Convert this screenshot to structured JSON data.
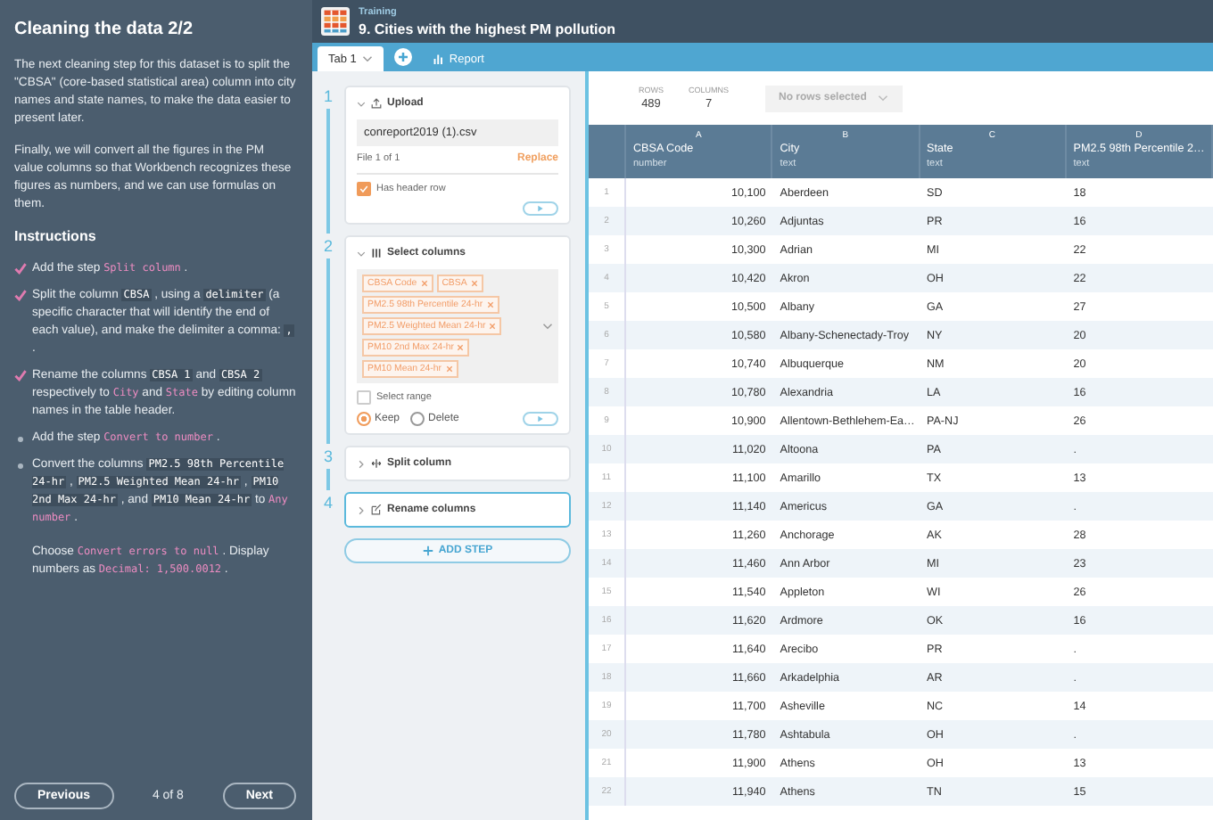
{
  "lesson": {
    "title": "Cleaning the data 2/2",
    "paragraphs": [
      [
        {
          "kind": "text",
          "t": "The next cleaning step for this dataset is to split the \"CBSA\" (core-based statistical area) column into city names and state names, to make the data easier to present later."
        }
      ],
      [
        {
          "kind": "text",
          "t": "Finally, we will convert all the figures in the PM value columns so that Workbench recognizes these figures as numbers, and we can use formulas on them."
        }
      ]
    ],
    "instructions_heading": "Instructions",
    "instructions": [
      {
        "done": true,
        "segments": [
          {
            "kind": "text",
            "t": "Add the step "
          },
          {
            "kind": "accent",
            "t": "Split column"
          },
          {
            "kind": "text",
            "t": " ."
          }
        ]
      },
      {
        "done": true,
        "segments": [
          {
            "kind": "text",
            "t": "Split the column "
          },
          {
            "kind": "code",
            "t": "CBSA"
          },
          {
            "kind": "text",
            "t": " , using a "
          },
          {
            "kind": "code",
            "t": "delimiter"
          },
          {
            "kind": "text",
            "t": " (a specific character that will identify the end of each value), and make the delimiter a comma: "
          },
          {
            "kind": "code",
            "t": ","
          },
          {
            "kind": "text",
            "t": " ."
          }
        ]
      },
      {
        "done": true,
        "segments": [
          {
            "kind": "text",
            "t": "Rename the columns "
          },
          {
            "kind": "code",
            "t": "CBSA 1"
          },
          {
            "kind": "text",
            "t": " and "
          },
          {
            "kind": "code",
            "t": "CBSA 2"
          },
          {
            "kind": "text",
            "t": " respectively to "
          },
          {
            "kind": "accent",
            "t": "City"
          },
          {
            "kind": "text",
            "t": " and "
          },
          {
            "kind": "accent",
            "t": "State"
          },
          {
            "kind": "text",
            "t": " by editing column names in the table header."
          }
        ]
      },
      {
        "done": false,
        "segments": [
          {
            "kind": "text",
            "t": "Add the step "
          },
          {
            "kind": "accent",
            "t": "Convert to number"
          },
          {
            "kind": "text",
            "t": " ."
          }
        ]
      },
      {
        "done": false,
        "segments": [
          {
            "kind": "text",
            "t": "Convert the columns "
          },
          {
            "kind": "code",
            "t": "PM2.5 98th Percentile 24-hr"
          },
          {
            "kind": "text",
            "t": " , "
          },
          {
            "kind": "code",
            "t": "PM2.5 Weighted Mean 24-hr"
          },
          {
            "kind": "text",
            "t": " , "
          },
          {
            "kind": "code",
            "t": "PM10 2nd Max 24-hr"
          },
          {
            "kind": "text",
            "t": " , and "
          },
          {
            "kind": "code",
            "t": "PM10 Mean 24-hr"
          },
          {
            "kind": "text",
            "t": " to "
          },
          {
            "kind": "accent",
            "t": "Any number"
          },
          {
            "kind": "text",
            "t": " ."
          }
        ]
      }
    ],
    "note": [
      {
        "kind": "text",
        "t": "Choose "
      },
      {
        "kind": "accent",
        "t": "Convert errors to null"
      },
      {
        "kind": "text",
        "t": " . Display numbers as "
      },
      {
        "kind": "accent",
        "t": "Decimal: 1,500.0012"
      },
      {
        "kind": "text",
        "t": " ."
      }
    ],
    "previous": "Previous",
    "page": "4 of 8",
    "next": "Next"
  },
  "header": {
    "section": "Training",
    "title": "9. Cities with the highest PM pollution"
  },
  "tabs": [
    {
      "kind": "tab",
      "label": "Tab 1",
      "selected": true
    },
    {
      "kind": "report",
      "label": "Report",
      "selected": false
    }
  ],
  "steps": [
    {
      "number": "1",
      "kind": "upload",
      "title": "Upload",
      "expanded": true,
      "selected": false,
      "file": "conreport2019 (1).csv",
      "file_count": "File 1 of 1",
      "replace": "Replace",
      "header_row": {
        "label": "Has header row",
        "checked": true
      }
    },
    {
      "number": "2",
      "kind": "select_columns",
      "title": "Select columns",
      "expanded": true,
      "selected": false,
      "tags": [
        "CBSA Code",
        "CBSA",
        "PM2.5 98th Percentile 24-hr",
        "PM2.5 Weighted Mean 24-hr",
        "PM10 2nd Max 24-hr",
        "PM10 Mean 24-hr"
      ],
      "select_range": {
        "label": "Select range",
        "checked": false
      },
      "options": [
        {
          "label": "Keep",
          "selected": true
        },
        {
          "label": "Delete",
          "selected": false
        }
      ]
    },
    {
      "number": "3",
      "kind": "split_column",
      "title": "Split column",
      "expanded": false,
      "selected": false
    },
    {
      "number": "4",
      "kind": "rename_columns",
      "title": "Rename columns",
      "expanded": false,
      "selected": true
    }
  ],
  "add_step": "ADD STEP",
  "table": {
    "rows_label": "ROWS",
    "rows_count": "489",
    "columns_label": "COLUMNS",
    "columns_count": "7",
    "selection": "No rows selected",
    "columns": [
      {
        "letter": "A",
        "name": "CBSA Code",
        "type": "number"
      },
      {
        "letter": "B",
        "name": "City",
        "type": "text"
      },
      {
        "letter": "C",
        "name": "State",
        "type": "text"
      },
      {
        "letter": "D",
        "name": "PM2.5 98th Percentile 2…",
        "type": "text"
      }
    ],
    "rows": [
      {
        "number": "1",
        "cells": [
          "10,100",
          "Aberdeen",
          "SD",
          "18"
        ]
      },
      {
        "number": "2",
        "cells": [
          "10,260",
          "Adjuntas",
          "PR",
          "16"
        ]
      },
      {
        "number": "3",
        "cells": [
          "10,300",
          "Adrian",
          "MI",
          "22"
        ]
      },
      {
        "number": "4",
        "cells": [
          "10,420",
          "Akron",
          "OH",
          "22"
        ]
      },
      {
        "number": "5",
        "cells": [
          "10,500",
          "Albany",
          "GA",
          "27"
        ]
      },
      {
        "number": "6",
        "cells": [
          "10,580",
          "Albany-Schenectady-Troy",
          "NY",
          "20"
        ]
      },
      {
        "number": "7",
        "cells": [
          "10,740",
          "Albuquerque",
          "NM",
          "20"
        ]
      },
      {
        "number": "8",
        "cells": [
          "10,780",
          "Alexandria",
          "LA",
          "16"
        ]
      },
      {
        "number": "9",
        "cells": [
          "10,900",
          "Allentown-Bethlehem-Ea…",
          "PA-NJ",
          "26"
        ]
      },
      {
        "number": "10",
        "cells": [
          "11,020",
          "Altoona",
          "PA",
          "."
        ]
      },
      {
        "number": "11",
        "cells": [
          "11,100",
          "Amarillo",
          "TX",
          "13"
        ]
      },
      {
        "number": "12",
        "cells": [
          "11,140",
          "Americus",
          "GA",
          "."
        ]
      },
      {
        "number": "13",
        "cells": [
          "11,260",
          "Anchorage",
          "AK",
          "28"
        ]
      },
      {
        "number": "14",
        "cells": [
          "11,460",
          "Ann Arbor",
          "MI",
          "23"
        ]
      },
      {
        "number": "15",
        "cells": [
          "11,540",
          "Appleton",
          "WI",
          "26"
        ]
      },
      {
        "number": "16",
        "cells": [
          "11,620",
          "Ardmore",
          "OK",
          "16"
        ]
      },
      {
        "number": "17",
        "cells": [
          "11,640",
          "Arecibo",
          "PR",
          "."
        ]
      },
      {
        "number": "18",
        "cells": [
          "11,660",
          "Arkadelphia",
          "AR",
          "."
        ]
      },
      {
        "number": "19",
        "cells": [
          "11,700",
          "Asheville",
          "NC",
          "14"
        ]
      },
      {
        "number": "20",
        "cells": [
          "11,780",
          "Ashtabula",
          "OH",
          "."
        ]
      },
      {
        "number": "21",
        "cells": [
          "11,900",
          "Athens",
          "OH",
          "13"
        ]
      },
      {
        "number": "22",
        "cells": [
          "11,940",
          "Athens",
          "TN",
          "15"
        ]
      }
    ]
  }
}
